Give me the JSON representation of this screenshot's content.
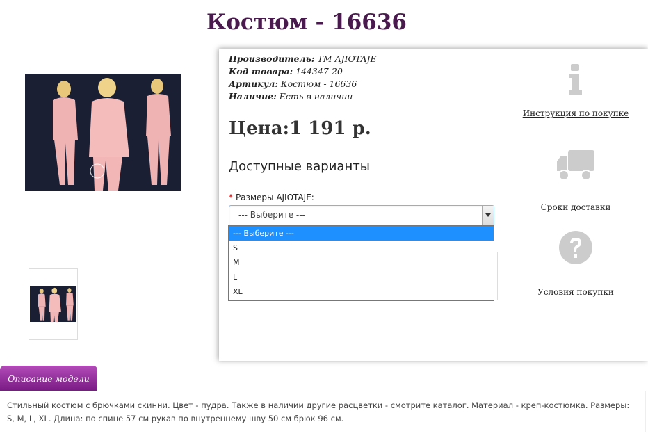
{
  "product": {
    "title": "Костюм - 16636",
    "manufacturer_label": "Производитель:",
    "manufacturer_value": "ТМ AJIOTAJE",
    "code_label": "Код товара:",
    "code_value": "144347-20",
    "article_label": "Артикул:",
    "article_value": "Костюм - 16636",
    "availability_label": "Наличие:",
    "availability_value": "Есть в наличии",
    "price_label": "Цена:",
    "price_value": "1 191 р."
  },
  "options": {
    "title": "Доступные варианты",
    "required_mark": "*",
    "size_label": "Размеры AJIOTAJE:",
    "selected": "--- Выберите ---",
    "items": [
      "--- Выберите ---",
      "S",
      "M",
      "L",
      "XL"
    ]
  },
  "sidebar": {
    "items": [
      {
        "label": "Инструкция по покупке",
        "icon": "info-icon"
      },
      {
        "label": "Сроки доставки",
        "icon": "truck-icon"
      },
      {
        "label": "Условия покупки",
        "icon": "question-icon"
      }
    ]
  },
  "description": {
    "tab_label": "Описание модели",
    "text": "Стильный костюм с брючками скинни. Цвет - пудра. Также в наличии другие расцветки - смотрите каталог. Материал - креп-костюмка. Размеры: S, M, L, XL. Длина: по спине 57 см рукав по внутреннему шву 50 см брюк 96 см."
  },
  "colors": {
    "title": "#4a1a4e",
    "tab_gradient_top": "#b24bb8",
    "tab_gradient_bottom": "#7a1a84",
    "dropdown_highlight": "#1e90ff",
    "icon_gray": "#cccccc"
  }
}
